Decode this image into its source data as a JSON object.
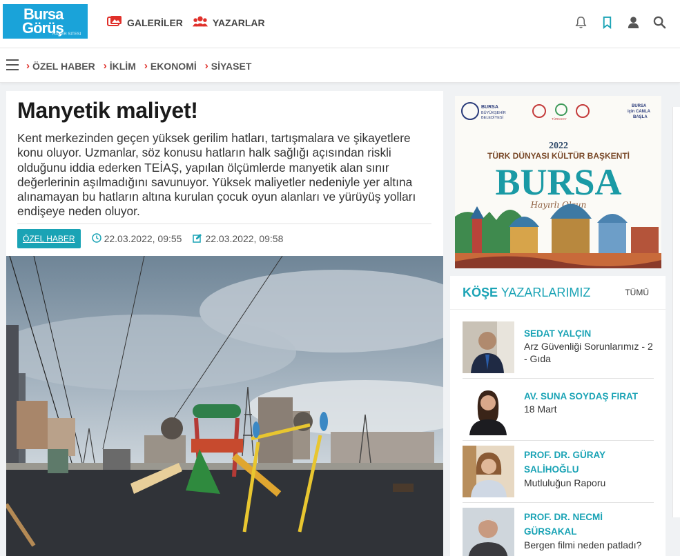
{
  "header": {
    "logo": {
      "line1": "Bursa",
      "line2": "Görüş",
      "tagline": "HABER SİTESİ"
    },
    "nav": [
      {
        "label": "GALERİLER",
        "icon": "gallery-icon"
      },
      {
        "label": "YAZARLAR",
        "icon": "users-icon"
      }
    ],
    "icons": [
      "bell-icon",
      "bookmark-icon",
      "user-icon",
      "search-icon"
    ]
  },
  "categories": [
    {
      "label": "ÖZEL HABER"
    },
    {
      "label": "İKLİM"
    },
    {
      "label": "EKONOMİ"
    },
    {
      "label": "SİYASET"
    }
  ],
  "article": {
    "title": "Manyetik maliyet!",
    "lead": "Kent merkezinden geçen yüksek gerilim hatları, tartışmalara ve şikayetlere konu oluyor. Uzmanlar, söz konusu hatların halk sağlığı açısından riskli olduğunu iddia ederken TEİAŞ, yapılan ölçümlerde manyetik alan sınır değerlerinin aşılmadığını savunuyor. Yüksek maliyetler nedeniyle yer altına alınamayan bu hatların altına kurulan çocuk oyun alanları ve yürüyüş yolları endişeye neden oluyor.",
    "badge": "ÖZEL HABER",
    "published": "22.03.2022, 09:55",
    "updated": "22.03.2022, 09:58"
  },
  "ad": {
    "org1": "BURSA",
    "org2": "BÜYÜKŞEHİR",
    "org3": "BELEDİYESİ",
    "logo_turksoy": "TÜRKSOY",
    "slogan1": "BURSA",
    "slogan2": "için CANLA",
    "slogan3": "BAŞLA",
    "year": "2022",
    "subtitle": "TÜRK DÜNYASI KÜLTÜR BAŞKENTİ",
    "city": "BURSA",
    "script": "Hayırlı Olsun"
  },
  "writers": {
    "heading_bold": "KÖŞE",
    "heading_rest": "YAZARLARIMIZ",
    "all_label": "TÜMÜ",
    "items": [
      {
        "name": "SEDAT YALÇIN",
        "title": "Arz Güvenliği Sorunlarımız - 2 - Gıda"
      },
      {
        "name": "AV. SUNA SOYDAŞ FIRAT",
        "title": "18 Mart"
      },
      {
        "name": "PROF. DR. GÜRAY SALİHOĞLU",
        "title": "Mutluluğun Raporu"
      },
      {
        "name": "PROF. DR. NECMİ GÜRSAKAL",
        "title": "Bergen filmi neden patladı?"
      }
    ]
  },
  "colors": {
    "accent": "#1aa3b5",
    "chevron": "#e0302a",
    "logo_bg": "#1aa3d9"
  }
}
